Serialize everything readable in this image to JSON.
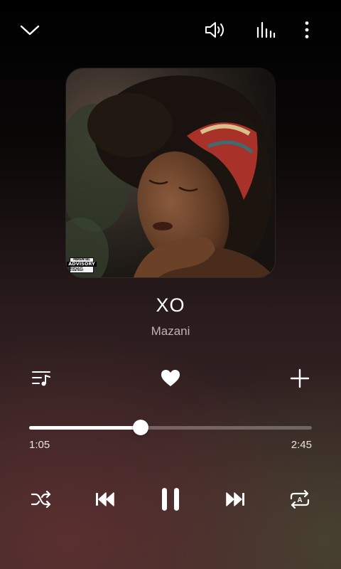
{
  "track": {
    "title": "XO",
    "artist": "Mazani",
    "progress": 0.395
  },
  "time": {
    "elapsed": "1:05",
    "total": "2:45"
  },
  "album_art": {
    "advisory_line1": "PARENTAL",
    "advisory_line2": "ADVISORY",
    "advisory_line3": "EXPLICIT CONTENT"
  },
  "icons": {
    "top": [
      "chevron-down-icon",
      "volume-icon",
      "equalizer-icon",
      "more-vertical-icon"
    ],
    "middle": [
      "queue-icon",
      "heart-icon",
      "add-icon"
    ],
    "controls": [
      "shuffle-icon",
      "previous-icon",
      "pause-icon",
      "next-icon",
      "repeat-icon"
    ]
  },
  "colors": {
    "accent": "#ffffff",
    "artist_text": "#bdb3b3"
  }
}
